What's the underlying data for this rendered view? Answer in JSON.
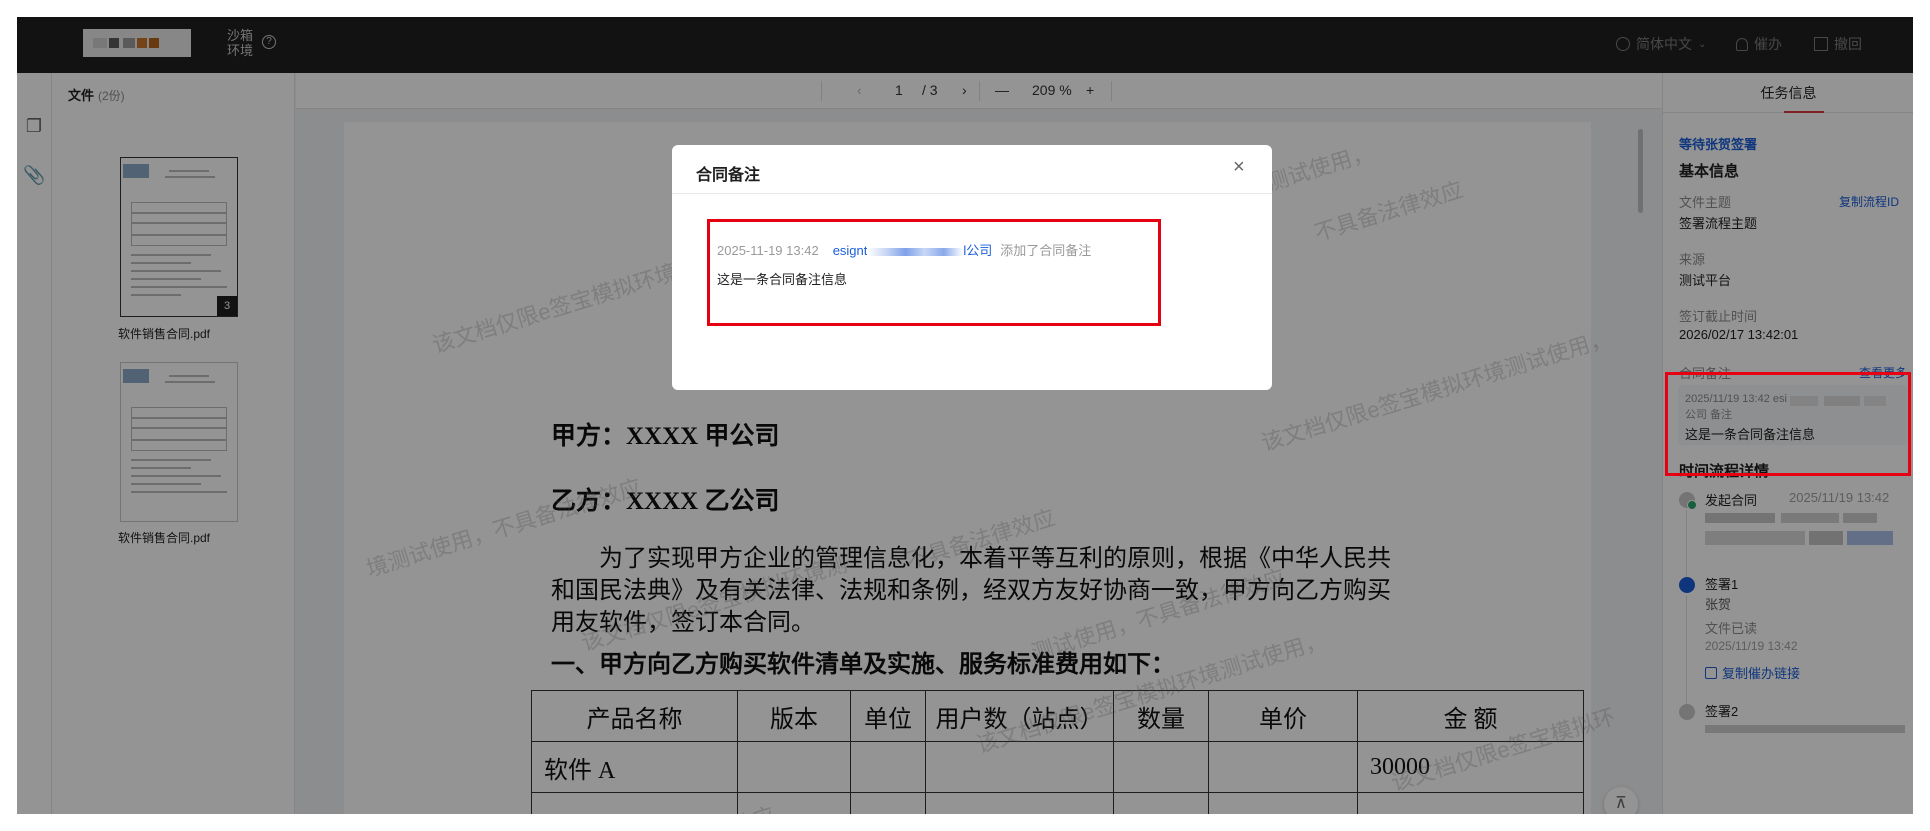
{
  "header": {
    "env_label": "沙箱环境",
    "language": "简体中文",
    "remind_label": "催办",
    "revoke_label": "撤回"
  },
  "files": {
    "title": "文件",
    "count": "(2份)",
    "items": [
      {
        "name": "软件销售合同.pdf",
        "pages": "3"
      },
      {
        "name": "软件销售合同.pdf"
      }
    ]
  },
  "viewer": {
    "page_current": "1",
    "page_total": "/ 3",
    "zoom": "209",
    "zoom_unit": "%",
    "document": {
      "party_a": "甲方：XXXX 甲公司",
      "party_b": "乙方：XXXX 乙公司",
      "paragraph_lines": [
        "为了实现甲方企业的管理信息化，本着平等互利的原则，根据《中华人民共",
        "和国民法典》及有关法律、法规和条例，经双方友好协商一致，甲方向乙方购买",
        "用友软件，签订本合同。"
      ],
      "section_title": "一、甲方向乙方购买软件清单及实施、服务标准费用如下：",
      "table_headers": [
        "产品名称",
        "版本",
        "单位",
        "用户数（站点）",
        "数量",
        "单价",
        "金  额"
      ],
      "table_rows": [
        [
          "软件 A",
          "",
          "",
          "",
          "",
          "",
          "30000"
        ],
        [
          "",
          "",
          "",
          "",
          "",
          "",
          ""
        ]
      ]
    },
    "watermarks": [
      "该文档仅限e签宝模拟环境测",
      "该文档仅限e签宝模拟环境测试使用，",
      "境测试使用，不具备法律效应",
      "不具备法律效应",
      "不具备法律效应",
      "测试使用，不具备法律效应",
      "该文档仅限e签宝模拟环境测试使用，",
      "该文档仅限e签宝模拟环",
      "律效应",
      "该文档仅限e签宝模拟环境测",
      "宝模拟环境测试使用，"
    ]
  },
  "right_panel": {
    "tab": "任务信息",
    "status": "等待张贺签署",
    "basic_title": "基本信息",
    "copy_flow_id": "复制流程ID",
    "subject_label": "文件主题",
    "subject_value": "签署流程主题",
    "source_label": "来源",
    "source_value": "测试平台",
    "deadline_label": "签订截止时间",
    "deadline_value": "2026/02/17 13:42:01",
    "note_label": "合同备注",
    "note_more": "查看更多",
    "note_meta_1": "2025/11/19 13:42 esi",
    "note_meta_2": "公司 备注",
    "note_text": "这是一条合同备注信息",
    "timeline_title": "时间流程详情",
    "timeline": [
      {
        "title": "发起合同",
        "time": "2025/11/19 13:42"
      },
      {
        "title": "签署1",
        "signer": "张贺",
        "state": "文件已读",
        "time": "2025/11/19 13:42",
        "action": "复制催办链接"
      },
      {
        "title": "签署2"
      }
    ]
  },
  "modal": {
    "title": "合同备注",
    "note_time": "2025-11-19 13:42",
    "note_user_prefix": "esignt",
    "note_user_suffix": "l公司",
    "note_action": "添加了合同备注",
    "note_text": "这是一条合同备注信息"
  },
  "colors": {
    "accent_blue": "#1a5ed8",
    "highlight_red": "#e60012",
    "topbar": "#1f1f1f",
    "success_green": "#2ba36a"
  },
  "icons": {
    "env_help": "question-circle-icon",
    "language": "globe-icon",
    "remind": "bell-icon",
    "revoke": "revoke-icon",
    "rail_files": "copy-files-icon",
    "rail_attach": "paperclip-icon",
    "modal_close": "close-icon",
    "copy_link": "link-icon",
    "to_top": "back-to-top-icon"
  }
}
